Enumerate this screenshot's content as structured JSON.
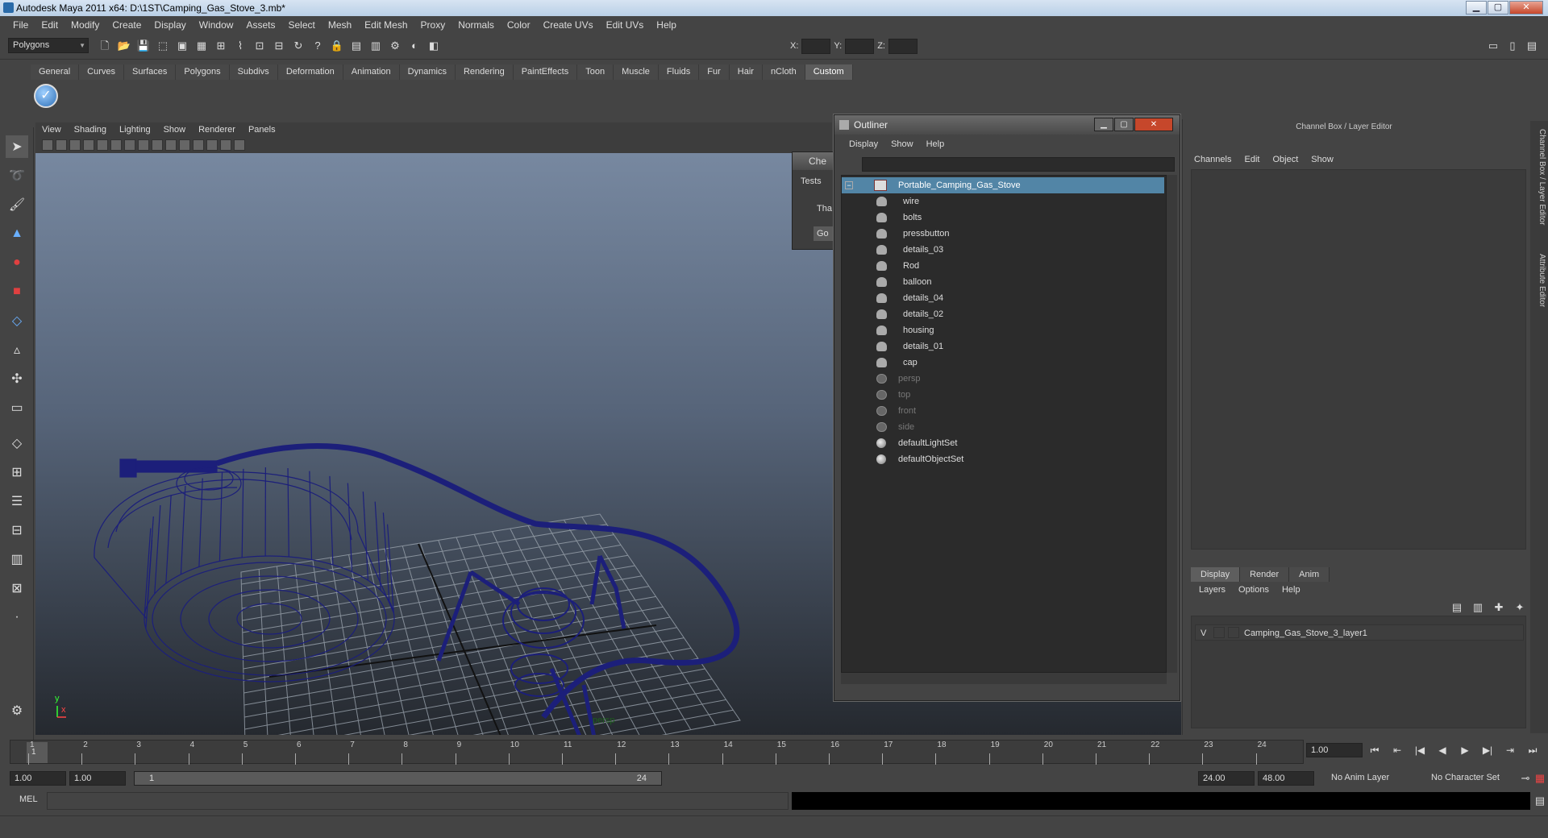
{
  "window": {
    "title": "Autodesk Maya 2011 x64: D:\\1ST\\Camping_Gas_Stove_3.mb*",
    "min": "▁",
    "max": "▢",
    "close": "✕"
  },
  "menubar": [
    "File",
    "Edit",
    "Modify",
    "Create",
    "Display",
    "Window",
    "Assets",
    "Select",
    "Mesh",
    "Edit Mesh",
    "Proxy",
    "Normals",
    "Color",
    "Create UVs",
    "Edit UVs",
    "Help"
  ],
  "toolbar": {
    "mode": "Polygons",
    "x_label": "X:",
    "y_label": "Y:",
    "z_label": "Z:"
  },
  "shelf": {
    "tabs": [
      "General",
      "Curves",
      "Surfaces",
      "Polygons",
      "Subdivs",
      "Deformation",
      "Animation",
      "Dynamics",
      "Rendering",
      "PaintEffects",
      "Toon",
      "Muscle",
      "Fluids",
      "Fur",
      "Hair",
      "nCloth",
      "Custom"
    ],
    "active_tab": "Custom",
    "custom_icon": "✓"
  },
  "viewport": {
    "menu": [
      "View",
      "Shading",
      "Lighting",
      "Show",
      "Renderer",
      "Panels"
    ],
    "camera_label": "persp",
    "axis_x": "x",
    "axis_y": "y"
  },
  "checker_window": {
    "title": "Che",
    "tab": "Tests",
    "text": "Tha",
    "button": "Go"
  },
  "outliner": {
    "title": "Outliner",
    "menu": [
      "Display",
      "Show",
      "Help"
    ],
    "root": "Portable_Camping_Gas_Stove",
    "children": [
      "wire",
      "bolts",
      "pressbutton",
      "details_03",
      "Rod",
      "balloon",
      "details_04",
      "details_02",
      "housing",
      "details_01",
      "cap"
    ],
    "cameras": [
      "persp",
      "top",
      "front",
      "side"
    ],
    "sets": [
      "defaultLightSet",
      "defaultObjectSet"
    ],
    "child_prefix": "o"
  },
  "channel_box": {
    "title": "Channel Box / Layer Editor",
    "menu": [
      "Channels",
      "Edit",
      "Object",
      "Show"
    ],
    "layer_tabs": [
      "Display",
      "Render",
      "Anim"
    ],
    "active_layer_tab": "Display",
    "layer_menu": [
      "Layers",
      "Options",
      "Help"
    ],
    "layer": {
      "visible": "V",
      "name": "Camping_Gas_Stove_3_layer1"
    },
    "side_tabs": [
      "Channel Box / Layer Editor",
      "Attribute Editor"
    ]
  },
  "timeline": {
    "ticks": [
      "1",
      "2",
      "3",
      "4",
      "5",
      "6",
      "7",
      "8",
      "9",
      "10",
      "11",
      "12",
      "13",
      "14",
      "15",
      "16",
      "17",
      "18",
      "19",
      "20",
      "21",
      "22",
      "23",
      "24"
    ],
    "current_frame": "1",
    "current_time_field": "1.00"
  },
  "range": {
    "start": "1.00",
    "playback_start": "1.00",
    "slider_start": "1",
    "slider_end": "24",
    "playback_end": "24.00",
    "end": "48.00",
    "anim_layer": "No Anim Layer",
    "char_set": "No Character Set"
  },
  "command": {
    "label": "MEL"
  },
  "colors": {
    "wireframe": "#1c1f7a",
    "selection": "#5285a6"
  }
}
